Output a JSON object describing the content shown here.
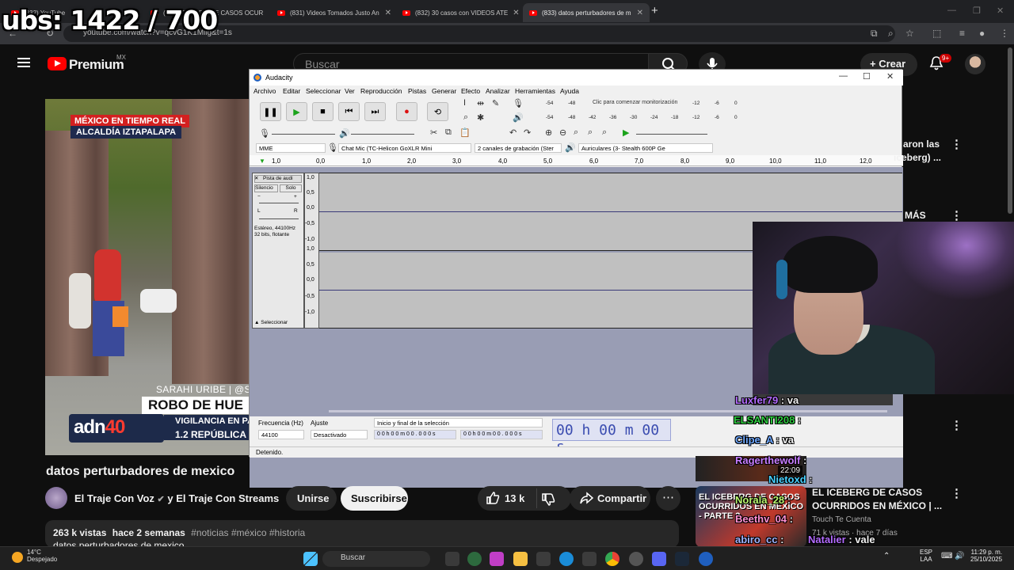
{
  "overlay": {
    "sub_counter": "ubs: 1422 / 700"
  },
  "browser": {
    "tabs": [
      {
        "label": "(832) YouTube",
        "active": false
      },
      {
        "label": "(831) ICEBERG DE CASOS OCURR",
        "active": false
      },
      {
        "label": "(831) Videos Tomados Justo An",
        "active": false
      },
      {
        "label": "(832) 30 casos con VIDEOS ATE",
        "active": false
      },
      {
        "label": "(833) datos perturbadores de m",
        "active": true
      }
    ],
    "url": "youtube.com/watch?v=qcvG1K1Milg&t=1s"
  },
  "youtube": {
    "logo_text": "Premium",
    "country": "MX",
    "search_placeholder": "Buscar",
    "create_label": "Crear",
    "notif_badge": "9+"
  },
  "video_overlay": {
    "tag1": "MÉXICO EN TIEMPO REAL",
    "tag2": "ALCALDÍA IZTAPALAPA",
    "reporter": "SARAHI URIBE | @S",
    "headline": "ROBO DE HUE",
    "sub1": "VIGILANCIA EN PANT",
    "sub2": "1.2 REPÚBLICA",
    "logo_a": "adn",
    "logo_b": "40"
  },
  "audacity": {
    "title": "Audacity",
    "menu": [
      "Archivo",
      "Editar",
      "Seleccionar",
      "Ver",
      "Reproducción",
      "Pistas",
      "Generar",
      "Efecto",
      "Analizar",
      "Herramientas",
      "Ayuda"
    ],
    "meter_hint": "Clic para comenzar monitorización",
    "meter_ticks_rec": [
      "-54",
      "-48",
      "-12",
      "-6",
      "0"
    ],
    "meter_ticks_play": [
      "-54",
      "-48",
      "-42",
      "-36",
      "-30",
      "-24",
      "-18",
      "-12",
      "-6",
      "0"
    ],
    "host": "MME",
    "mic": "Chat Mic (TC-Helicon GoXLR Mini",
    "channels": "2 canales de grabación (Ster",
    "speaker": "Auriculares (3- Stealth 600P Ge",
    "ruler": [
      "1,0",
      "0,0",
      "1,0",
      "2,0",
      "3,0",
      "4,0",
      "5,0",
      "6,0",
      "7,0",
      "8,0",
      "9,0",
      "10,0",
      "11,0",
      "12,0"
    ],
    "track_name": "Pista de audi",
    "mute": "Silencio",
    "solo": "Solo",
    "pan_l": "L",
    "pan_r": "R",
    "track_info": "Estéreo, 44100Hz",
    "track_info2": "32 bits, flotante",
    "select": "Seleccionar",
    "scale": [
      "1,0",
      "0,5",
      "0,0",
      "-0,5",
      "-1,0",
      "1,0",
      "0,5",
      "0,0",
      "-0,5",
      "-1,0"
    ],
    "rate_label": "Frecuencia (Hz)",
    "rate": "44100",
    "snap_label": "Ajuste",
    "snap": "Desactivado",
    "sel_label": "Inicio y final de la selección",
    "sel_start": "0 0 h 0 0 m 0 0 . 0 0 0 s",
    "sel_end": "0 0 h 0 0 m 0 0 . 0 0 0 s",
    "time": "00 h 00 m 00 s",
    "status": "Detenido."
  },
  "chat": [
    {
      "user": "Luxfer79",
      "msg": ": va",
      "color": "#b36bff"
    },
    {
      "user": "ELSANTI208",
      "msg": ":",
      "color": "#2ecc40"
    },
    {
      "user": "Clipe_A",
      "msg": ": va",
      "color": "#6fa8ff"
    },
    {
      "user": "Ragerthewolf",
      "msg": ":",
      "color": "#c77dff"
    },
    {
      "user": "Nietoxd",
      "msg": ":",
      "color": "#48d1ff"
    },
    {
      "user": "Norala_28",
      "msg": ":",
      "color": "#b9f56e"
    },
    {
      "user": "Beethv_04",
      "msg": ":",
      "color": "#ff8fd1"
    },
    {
      "user": "abiro_cc",
      "msg": ":",
      "color": "#9fb4ff"
    },
    {
      "user": "Natalier",
      "msg": ": vale",
      "color": "#b36bff"
    }
  ],
  "video_info": {
    "title": "datos perturbadores de mexico",
    "channel": "El Traje Con Voz",
    "channel2": "y El Traje Con Streams",
    "join": "Unirse",
    "subscribe": "Suscribirse",
    "likes": "13 k",
    "share": "Compartir",
    "views": "263 k vistas",
    "ago": "hace 2 semanas",
    "tags": "#noticias #méxico #historia",
    "desc_line": "datos perturbadores de mexico"
  },
  "sidebar": {
    "item1_line1": "aron las",
    "item1_line2": "iceberg) ...",
    "item2": "MÁS",
    "rec_title_1": "EL ICEBERG DE CASOS",
    "rec_title_2": "OCURRIDOS EN MÉXICO | ...",
    "rec_channel": "Touch Te Cuenta",
    "rec_meta": "71 k vistas · hace 7 días",
    "rec_thumb_text": "EL ICEBERG DE CASOS OCURRIDOS EN MÉXICO - PARTE 2",
    "rec_time": "22:09"
  },
  "taskbar": {
    "temp": "14°C",
    "weather": "Despejado",
    "search": "Buscar",
    "lang1": "ESP",
    "lang2": "LAA",
    "time": "11:29 p. m.",
    "date": "25/10/2025"
  }
}
